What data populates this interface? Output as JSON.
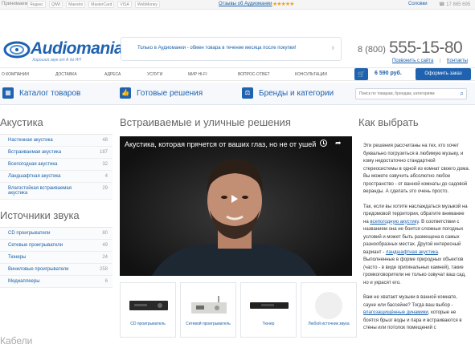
{
  "topbar": {
    "accept_label": "Принимаем:",
    "payment_logos": [
      "Яндекс",
      "QIWI",
      "Maestro",
      "MasterCard",
      "VISA",
      "WebMoney"
    ],
    "reviews_link": "Отзывы об Аудиомании",
    "rating_stars": "★★★★★",
    "city": "Соловки",
    "small_phone": "☎ 17 865 695"
  },
  "header": {
    "logo_name": "Audiomania",
    "logo_tagline": "Хороший звук от А до Я!!!",
    "promo_text": "Только в Аудиомании - обмен товара в течение месяца после покупки!",
    "phone_prefix": "8 (800)",
    "phone_number": "555-15-80",
    "callback_link": "Позвонить с сайта",
    "separator": "|",
    "contacts_link": "Контакты"
  },
  "nav": {
    "items": [
      "О компании",
      "Доставка",
      "Адреса",
      "Услуги",
      "Мир Hi-Fi",
      "Вопрос-ответ",
      "Консультации"
    ]
  },
  "cart": {
    "icon": "cart-icon",
    "total": "6 590 руб.",
    "order_button": "Оформить заказ"
  },
  "catbar": {
    "items": [
      {
        "label": "Каталог товаров",
        "icon": "grid-icon"
      },
      {
        "label": "Готовые решения",
        "icon": "thumbs-up-icon"
      },
      {
        "label": "Бренды и категории",
        "icon": "scale-icon"
      }
    ],
    "search_placeholder": "Поиск по товарам, брендам, категориям"
  },
  "sidebar": {
    "acoustics_title": "Акустика",
    "acoustics_items": [
      {
        "label": "Настенная акустика",
        "count": "48"
      },
      {
        "label": "Встраиваемая акустика",
        "count": "187"
      },
      {
        "label": "Всепогодная акустика",
        "count": "32"
      },
      {
        "label": "Ландшафтная акустика",
        "count": "4"
      },
      {
        "label": "Влагостойкая встраиваемая акустика",
        "count": "29"
      }
    ],
    "sources_title": "Источники звука",
    "sources_items": [
      {
        "label": "CD проигрыватели",
        "count": "80"
      },
      {
        "label": "Сетевые проигрыватели",
        "count": "49"
      },
      {
        "label": "Тюнеры",
        "count": "24"
      },
      {
        "label": "Виниловые проигрыватели",
        "count": "258"
      },
      {
        "label": "Медиаплееры",
        "count": "6"
      }
    ],
    "cut_title": "Кабели"
  },
  "main": {
    "title": "Встраиваемые и уличные решения",
    "video_title": "Акустика, которая прячется от ваших глаз, но не от ушей",
    "products": [
      {
        "label": "CD проигрыватель"
      },
      {
        "label": "Сетевой проигрыватель"
      },
      {
        "label": "Тюнер"
      },
      {
        "label": "Любой источник звука"
      }
    ]
  },
  "right": {
    "title": "Как выбрать",
    "p1": "Эти решения рассчитаны на тех, кто хочет буквально погрузиться в любимую музыку, и кому недостаточно стандартной стереосистемы в одной из комнат своего дома. Вы можете озвучить абсолютно любое пространство - от ванной комнаты до садовой веранды. А сделать это очень просто.",
    "p2a": "Так, если вы хотите наслаждаться музыкой на придомовой территории, обратите внимание на ",
    "p2_link1": "всепогодную акустику",
    "p2b": ". В соответствии с названием она не боится сложных погодных условий и может быть размещена в самых разнообразных местах. Другой интересный вариант - ",
    "p2_link2": "ландшафтная акустика",
    "p2c": ". Выполненные в форме природных объектов (часто - в виде оригинальных камней), такие громкоговорители не только озвучат ваш сад, но и украсят его.",
    "p3a": "Вам не хватает музыки в ванной комнате, сауне или бассейне? Тогда ваш выбор - ",
    "p3_link": "влагозащищённые динамики",
    "p3b": ", которые не боятся брызг воды и пара и встраиваются в стены или потолок помещений с"
  }
}
